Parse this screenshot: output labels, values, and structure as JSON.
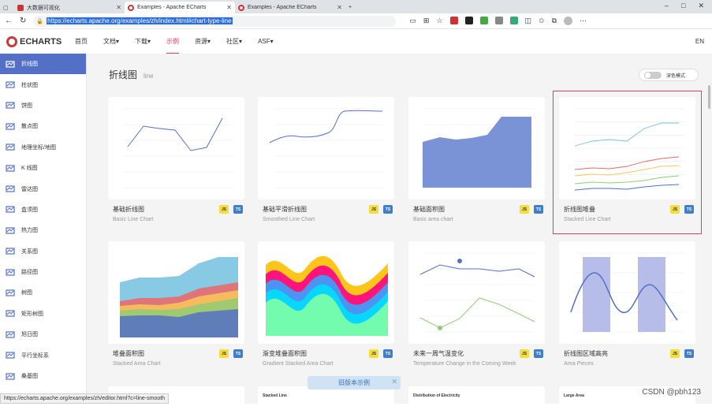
{
  "browser": {
    "tabs": [
      {
        "label": "大数据可视化",
        "active": false
      },
      {
        "label": "Examples - Apache ECharts",
        "active": true
      },
      {
        "label": "Examples - Apache ECharts",
        "active": false
      }
    ],
    "new_tab": "+",
    "url": "https://echarts.apache.org/examples/zh/index.html#chart-type-line",
    "window_controls": [
      "–",
      "□",
      "✕"
    ]
  },
  "nav": {
    "logo": "ECHARTS",
    "items": [
      "首页",
      "文档▾",
      "下载▾",
      "示例",
      "资源▾",
      "社区▾",
      "ASF▾"
    ],
    "active_index": 3,
    "lang": "EN"
  },
  "sidebar": {
    "items": [
      {
        "label": "折线图",
        "icon": "line-chart-icon"
      },
      {
        "label": "柱状图",
        "icon": "bar-chart-icon"
      },
      {
        "label": "饼图",
        "icon": "pie-chart-icon"
      },
      {
        "label": "散点图",
        "icon": "scatter-icon"
      },
      {
        "label": "地理坐标/地图",
        "icon": "map-icon"
      },
      {
        "label": "K 线图",
        "icon": "candlestick-icon"
      },
      {
        "label": "雷达图",
        "icon": "radar-icon"
      },
      {
        "label": "盒须图",
        "icon": "boxplot-icon"
      },
      {
        "label": "热力图",
        "icon": "heatmap-icon"
      },
      {
        "label": "关系图",
        "icon": "graph-icon"
      },
      {
        "label": "路径图",
        "icon": "lines-icon"
      },
      {
        "label": "树图",
        "icon": "tree-icon"
      },
      {
        "label": "矩形树图",
        "icon": "treemap-icon"
      },
      {
        "label": "旭日图",
        "icon": "sunburst-icon"
      },
      {
        "label": "平行坐标系",
        "icon": "parallel-icon"
      },
      {
        "label": "桑基图",
        "icon": "sankey-icon"
      }
    ],
    "active_index": 0
  },
  "main": {
    "title": "折线图",
    "title_sub": "line",
    "dark_mode_label": "深色模式",
    "cards": [
      {
        "title": "基础折线图",
        "subtitle": "Basic Line Chart",
        "thumb": "basic-line"
      },
      {
        "title": "基础平滑折线图",
        "subtitle": "Smoothed Line Chart",
        "thumb": "smooth-line"
      },
      {
        "title": "基础面积图",
        "subtitle": "Basic area chart",
        "thumb": "basic-area"
      },
      {
        "title": "折线图堆叠",
        "subtitle": "Stacked Line Chart",
        "thumb": "stacked-line"
      },
      {
        "title": "堆叠面积图",
        "subtitle": "Stacked Area Chart",
        "thumb": "stacked-area"
      },
      {
        "title": "渐变堆叠面积图",
        "subtitle": "Gradient Stacked Area Chart",
        "thumb": "gradient-area"
      },
      {
        "title": "未来一周气温变化",
        "subtitle": "Temperature Change in the Coming Week",
        "thumb": "temperature"
      },
      {
        "title": "折线图区域高亮",
        "subtitle": "Area Pieces",
        "thumb": "area-pieces"
      }
    ],
    "bottom_card_titles": [
      "",
      "Stacked Line",
      "Distribution of Electricity",
      "Large Area"
    ],
    "badge_js": "JS",
    "badge_ts": "TS",
    "old_examples": "旧版本示例",
    "old_close": "✕"
  },
  "status_url": "https://echarts.apache.org/examples/zh/editor.html?c=line-smooth",
  "watermark": "CSDN @pbh123",
  "colors": {
    "accent": "#5470c6",
    "active_nav": "#e43c59",
    "js": "#f5dd3c",
    "ts": "#3f7fc9"
  }
}
